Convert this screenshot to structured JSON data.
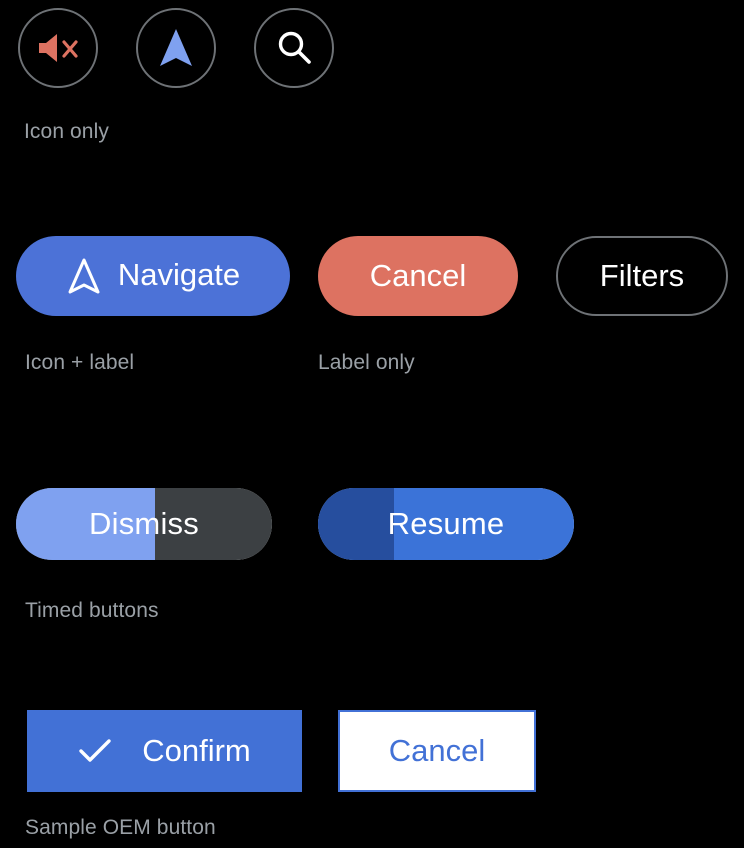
{
  "theme": {
    "background": "#000000",
    "caption_color": "#9AA0A6",
    "outline_color": "#6E7276",
    "accent_blue": "#4C72D7",
    "accent_blue_light": "#7FA1F0",
    "accent_blue_dark": "#264E9E",
    "accent_red": "#DD7261",
    "track_gray": "#3C4043",
    "white": "#FFFFFF"
  },
  "sections": {
    "icon_only": {
      "caption": "Icon only",
      "buttons": [
        {
          "name": "mute",
          "icon": "volume-off-icon",
          "icon_color": "#DD7261"
        },
        {
          "name": "navigate",
          "icon": "navigation-arrow-icon",
          "icon_color": "#7FA1F0"
        },
        {
          "name": "search",
          "icon": "search-icon",
          "icon_color": "#FFFFFF"
        }
      ]
    },
    "icon_label": {
      "caption": "Icon + label",
      "button": {
        "label": "Navigate",
        "icon": "navigation-arrow-outline-icon",
        "background": "#4C72D7",
        "text_color": "#FFFFFF"
      }
    },
    "label_only": {
      "caption": "Label only",
      "buttons": [
        {
          "label": "Cancel",
          "background": "#DD7261",
          "text_color": "#FFFFFF"
        },
        {
          "label": "Filters",
          "background": "#000000",
          "text_color": "#FFFFFF",
          "border": "#6E7276"
        }
      ]
    },
    "timed": {
      "caption": "Timed buttons",
      "buttons": [
        {
          "label": "Dismiss",
          "progress": 54,
          "fill": "#7FA1F0",
          "track": "#3C4043"
        },
        {
          "label": "Resume",
          "progress": 30,
          "fill": "#264E9E",
          "track": "#3B73D8"
        }
      ]
    },
    "oem": {
      "caption": "Sample OEM button",
      "buttons": [
        {
          "label": "Confirm",
          "icon": "check-icon",
          "background": "#4271D6",
          "text_color": "#FFFFFF"
        },
        {
          "label": "Cancel",
          "background": "#FFFFFF",
          "text_color": "#4271D6",
          "border": "#4271D6"
        }
      ]
    }
  }
}
